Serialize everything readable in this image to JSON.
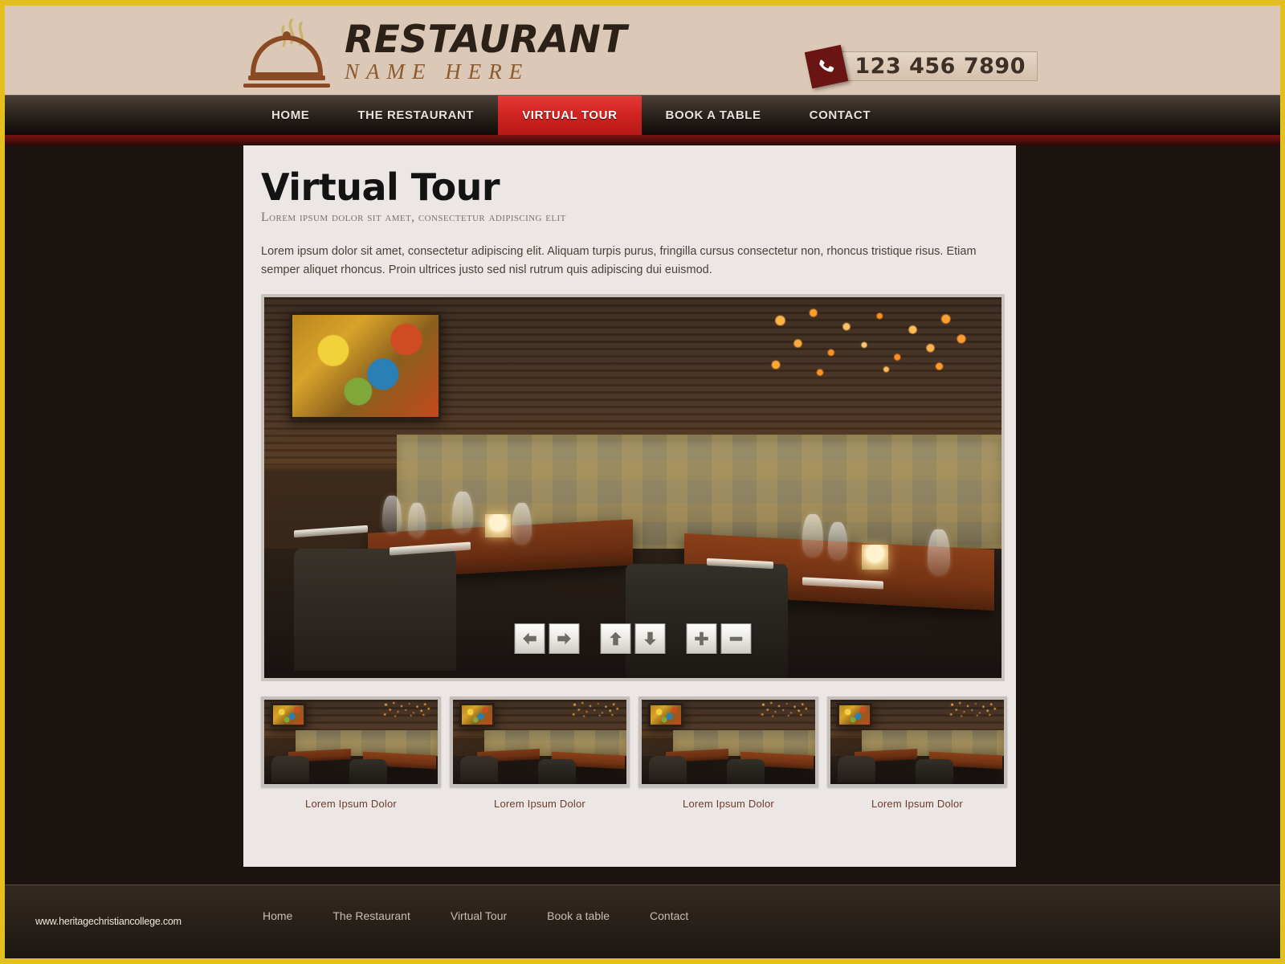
{
  "brand": {
    "name_line1": "RESTAURANT",
    "name_line2": "NAME HERE",
    "logo_icon": "cloche-dome-icon",
    "accent_red": "#d02320",
    "accent_gold": "#e3c01f",
    "header_bg": "#dcc8b6"
  },
  "header": {
    "phone_icon": "phone-handset-icon",
    "phone_number": "123 456 7890"
  },
  "nav": {
    "items": [
      {
        "label": "HOME",
        "active": false
      },
      {
        "label": "THE RESTAURANT",
        "active": false
      },
      {
        "label": "VIRTUAL TOUR",
        "active": true
      },
      {
        "label": "BOOK A TABLE",
        "active": false
      },
      {
        "label": "CONTACT",
        "active": false
      }
    ]
  },
  "page": {
    "title": "Virtual Tour",
    "subtitle": "Lorem ipsum dolor sit amet, consectetur adipiscing elit",
    "paragraph": "Lorem ipsum dolor sit amet, consectetur adipiscing elit. Aliquam turpis purus, fringilla cursus consectetur non, rhoncus tristique risus. Etiam semper aliquet rhoncus. Proin ultrices justo sed nisl rutrum quis adipiscing dui euismod."
  },
  "viewer": {
    "alt": "Restaurant interior with set dining tables and banquette seating",
    "controls": [
      {
        "name": "pan-left-button",
        "icon": "arrow-left-icon",
        "label": "Pan left"
      },
      {
        "name": "pan-right-button",
        "icon": "arrow-right-icon",
        "label": "Pan right"
      },
      {
        "name": "pan-up-button",
        "icon": "arrow-up-icon",
        "label": "Pan up"
      },
      {
        "name": "pan-down-button",
        "icon": "arrow-down-icon",
        "label": "Pan down"
      },
      {
        "name": "zoom-in-button",
        "icon": "plus-icon",
        "label": "Zoom in"
      },
      {
        "name": "zoom-out-button",
        "icon": "minus-icon",
        "label": "Zoom out"
      }
    ]
  },
  "thumbnails": [
    {
      "caption": "Lorem Ipsum Dolor"
    },
    {
      "caption": "Lorem Ipsum Dolor"
    },
    {
      "caption": "Lorem Ipsum Dolor"
    },
    {
      "caption": "Lorem Ipsum Dolor"
    }
  ],
  "footer": {
    "url": "www.heritagechristiancollege.com",
    "links": [
      {
        "label": "Home"
      },
      {
        "label": "The Restaurant"
      },
      {
        "label": "Virtual Tour"
      },
      {
        "label": "Book a table"
      },
      {
        "label": "Contact"
      }
    ]
  }
}
